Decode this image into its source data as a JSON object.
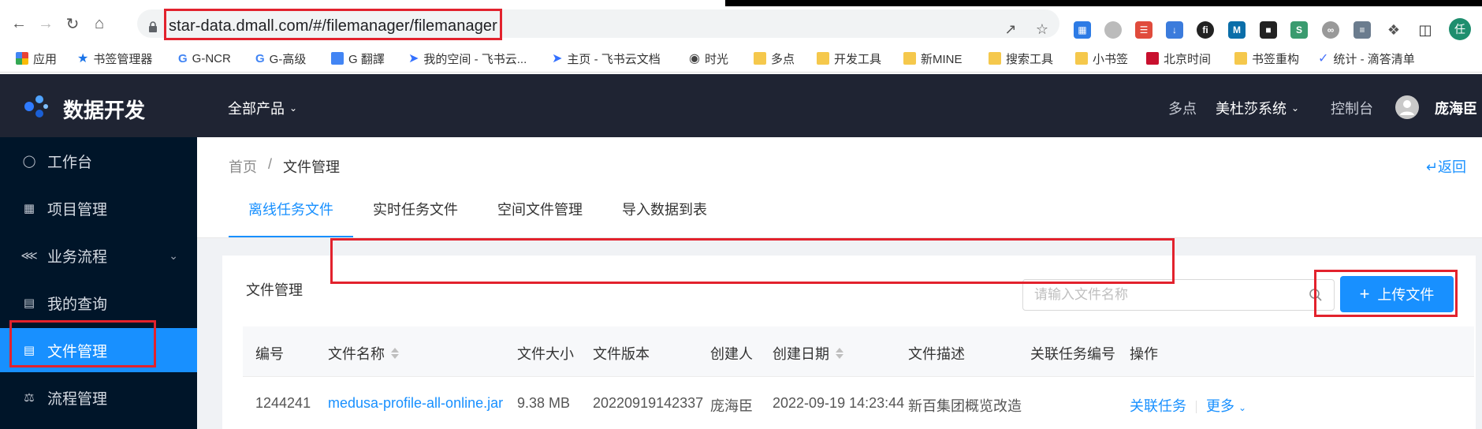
{
  "browser": {
    "url": "star-data.dmall.com/#/filemanager/filemanager",
    "avatar_letter": "任",
    "bookmarks": [
      {
        "label": "应用",
        "icon": "apps-grid-icon"
      },
      {
        "label": "书签管理器",
        "icon": "star-icon"
      },
      {
        "label": "G-NCR",
        "icon": "google-icon"
      },
      {
        "label": "G-高级",
        "icon": "google-icon"
      },
      {
        "label": "G 翻譯",
        "icon": "translate-icon"
      },
      {
        "label": "我的空间 - 飞书云...",
        "icon": "feishu-icon"
      },
      {
        "label": "主页 - 飞书云文档",
        "icon": "feishu-icon"
      },
      {
        "label": "时光",
        "icon": "globe-icon"
      },
      {
        "label": "多点",
        "icon": "folder-icon"
      },
      {
        "label": "开发工具",
        "icon": "folder-icon"
      },
      {
        "label": "新MINE",
        "icon": "folder-icon"
      },
      {
        "label": "搜索工具",
        "icon": "folder-icon"
      },
      {
        "label": "小书签",
        "icon": "folder-icon"
      },
      {
        "label": "北京时间",
        "icon": "bookmark-red-icon"
      },
      {
        "label": "书签重构",
        "icon": "folder-icon"
      },
      {
        "label": "统计 - 滴答清单",
        "icon": "check-icon"
      }
    ]
  },
  "header": {
    "app_title": "数据开发",
    "all_products": "全部产品",
    "link_duodian": "多点",
    "system_select": "美杜莎系统",
    "console": "控制台",
    "user_name": "庞海臣"
  },
  "sidebar": {
    "items": [
      {
        "label": "工作台",
        "icon": "dashboard-icon"
      },
      {
        "label": "项目管理",
        "icon": "grid-icon"
      },
      {
        "label": "业务流程",
        "icon": "share-icon"
      },
      {
        "label": "我的查询",
        "icon": "query-icon"
      },
      {
        "label": "文件管理",
        "icon": "file-icon"
      },
      {
        "label": "流程管理",
        "icon": "flow-icon"
      }
    ],
    "active_index": 4
  },
  "page": {
    "breadcrumb": [
      "首页",
      "/",
      "文件管理"
    ],
    "back": "返回",
    "tabs": [
      "离线任务文件",
      "实时任务文件",
      "空间文件管理",
      "导入数据到表"
    ],
    "active_tab": 0,
    "card_title": "文件管理",
    "search_placeholder": "请输入文件名称",
    "upload_label": "上传文件"
  },
  "table": {
    "columns": [
      "编号",
      "文件名称",
      "文件大小",
      "文件版本",
      "创建人",
      "创建日期",
      "文件描述",
      "关联任务编号",
      "操作"
    ],
    "rows": [
      {
        "id": "1244241",
        "name": "medusa-profile-all-online.jar",
        "size": "9.38 MB",
        "version": "20220919142337",
        "creator": "庞海臣",
        "created": "2022-09-19 14:23:44",
        "desc": "新百集团概览改造",
        "task_id": "",
        "action_link": "关联任务",
        "action_more": "更多"
      }
    ]
  },
  "colors": {
    "accent": "#1890ff",
    "header_bg": "#1f2433",
    "sidebar_bg": "#001529",
    "highlight": "#e2222d"
  }
}
